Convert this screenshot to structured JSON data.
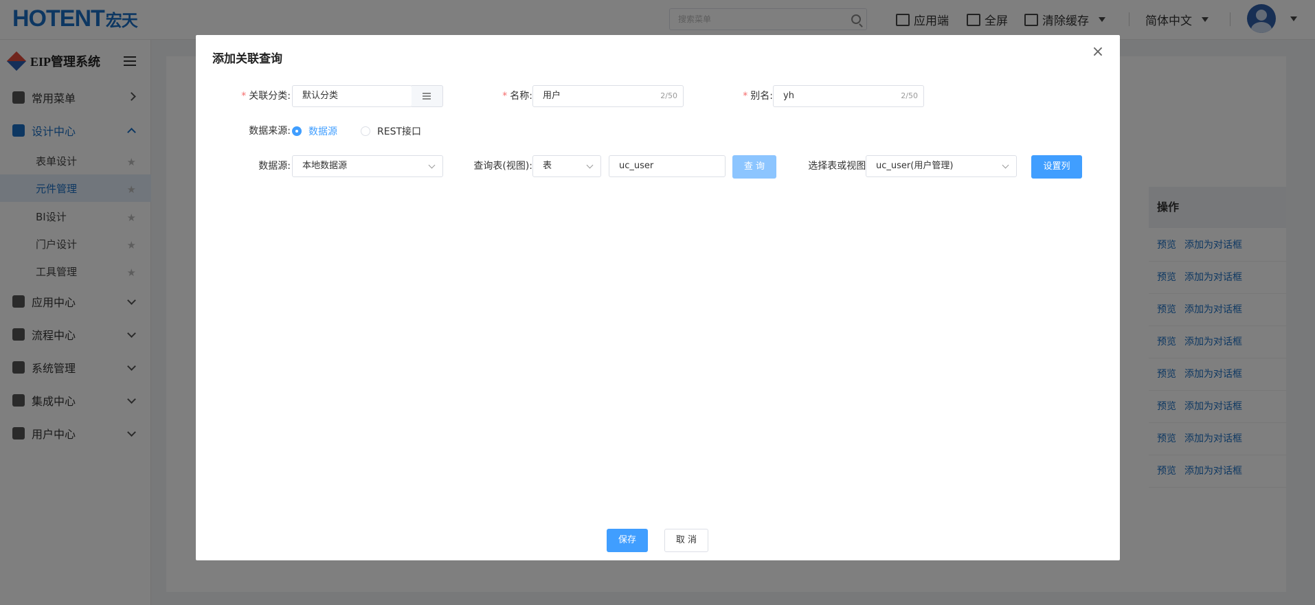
{
  "header": {
    "logo_latin": "HOTENT",
    "logo_cn": "宏天",
    "search_placeholder": "搜索菜单",
    "app_label": "应用端",
    "fullscreen_label": "全屏",
    "clear_cache_label": "清除缓存",
    "language_label": "简体中文"
  },
  "sidebar": {
    "system_name": "EIP管理系统",
    "menus": [
      {
        "label": "常用菜单"
      },
      {
        "label": "设计中心"
      },
      {
        "label": "应用中心"
      },
      {
        "label": "流程中心"
      },
      {
        "label": "系统管理"
      },
      {
        "label": "集成中心"
      },
      {
        "label": "用户中心"
      }
    ],
    "design_sub": [
      {
        "label": "表单设计"
      },
      {
        "label": "元件管理"
      },
      {
        "label": "BI设计"
      },
      {
        "label": "门户设计"
      },
      {
        "label": "工具管理"
      }
    ]
  },
  "background_table": {
    "op_header": "操作",
    "row_actions": [
      "预览",
      "添加为对话框"
    ],
    "row_count": 8
  },
  "dialog": {
    "title": "添加关联查询",
    "category_label": "关联分类:",
    "category_value": "默认分类",
    "name_label": "名称:",
    "name_value": "用户",
    "name_count": "2/50",
    "alias_label": "别名:",
    "alias_value": "yh",
    "alias_count": "2/50",
    "source_label": "数据来源:",
    "source_options": [
      "数据源",
      "REST接口"
    ],
    "source_selected": "数据源",
    "datasource_label": "数据源:",
    "datasource_value": "本地数据源",
    "query_table_label": "查询表(视图):",
    "query_type_value": "表",
    "query_input_value": "uc_user",
    "query_button": "查 询",
    "select_table_label": "选择表或视图:",
    "select_table_value": "uc_user(用户管理)",
    "set_columns_button": "设置列",
    "save_button": "保存",
    "cancel_button": "取 消"
  },
  "colors": {
    "primary": "#409eff",
    "brand": "#1a6fc4",
    "required": "#f56c6c"
  }
}
